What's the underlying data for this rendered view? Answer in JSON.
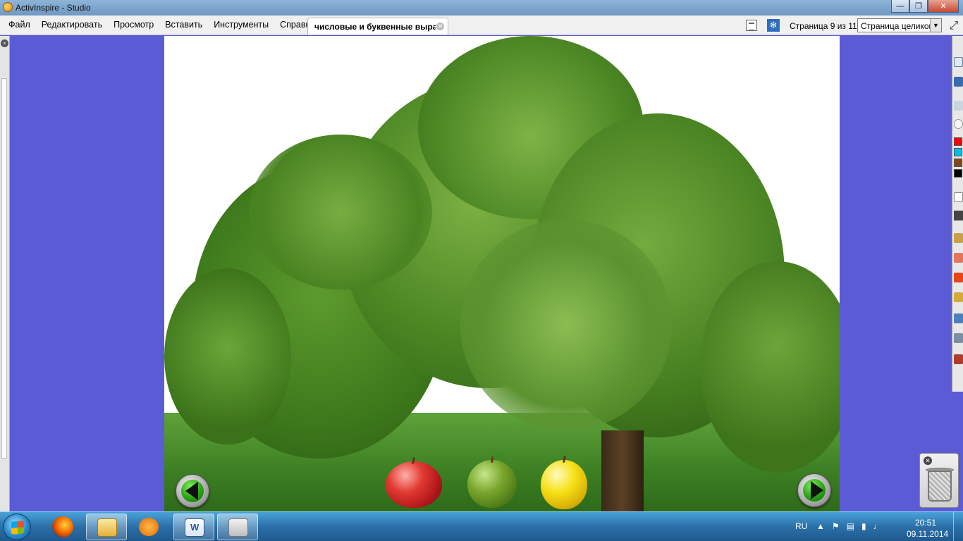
{
  "window": {
    "title": "ActivInspire - Studio"
  },
  "menubar": {
    "items": [
      "Файл",
      "Редактировать",
      "Просмотр",
      "Вставить",
      "Инструменты",
      "Справка"
    ]
  },
  "document_tab": {
    "label": "числовые и буквенные выра"
  },
  "page_indicator": "Страница 9 из 11",
  "zoom": {
    "selected": "Страница целиком"
  },
  "canvas": {
    "apples": [
      "red-apple",
      "green-apple",
      "yellow-apple"
    ],
    "nav": [
      "prev-page-button",
      "next-page-button"
    ]
  },
  "toolbox_colors": [
    "#ff0000",
    "#00c0e8",
    "#8b4513",
    "#000000"
  ],
  "taskbar": {
    "language": "RU",
    "time": "20:51",
    "date": "09.11.2014"
  }
}
